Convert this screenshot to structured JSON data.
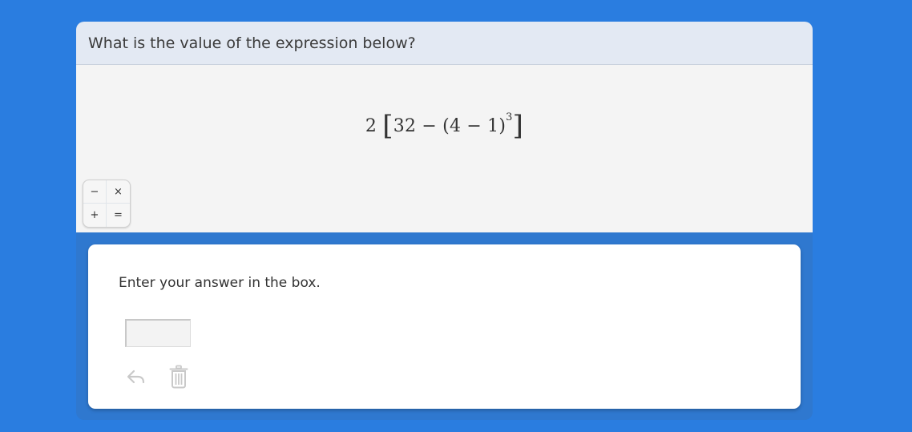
{
  "question": {
    "text": "What is the value of the expression below?"
  },
  "expression": {
    "coefficient": "2",
    "open_bracket": "[",
    "inner_left": "32 − (4 − 1)",
    "exponent": "3",
    "close_bracket": "]"
  },
  "calculator_tools": {
    "items": [
      "−",
      "×",
      "+",
      "="
    ]
  },
  "response": {
    "prompt": "Enter your answer in the box.",
    "answer_value": "",
    "undo_icon": "undo-icon",
    "delete_icon": "trash-icon"
  },
  "colors": {
    "background": "#2a7de0",
    "header_bg": "#e3e9f3",
    "stimulus_bg": "#f4f4f4",
    "panel_bg": "#ffffff",
    "icon_gray": "#c9c9c9"
  }
}
